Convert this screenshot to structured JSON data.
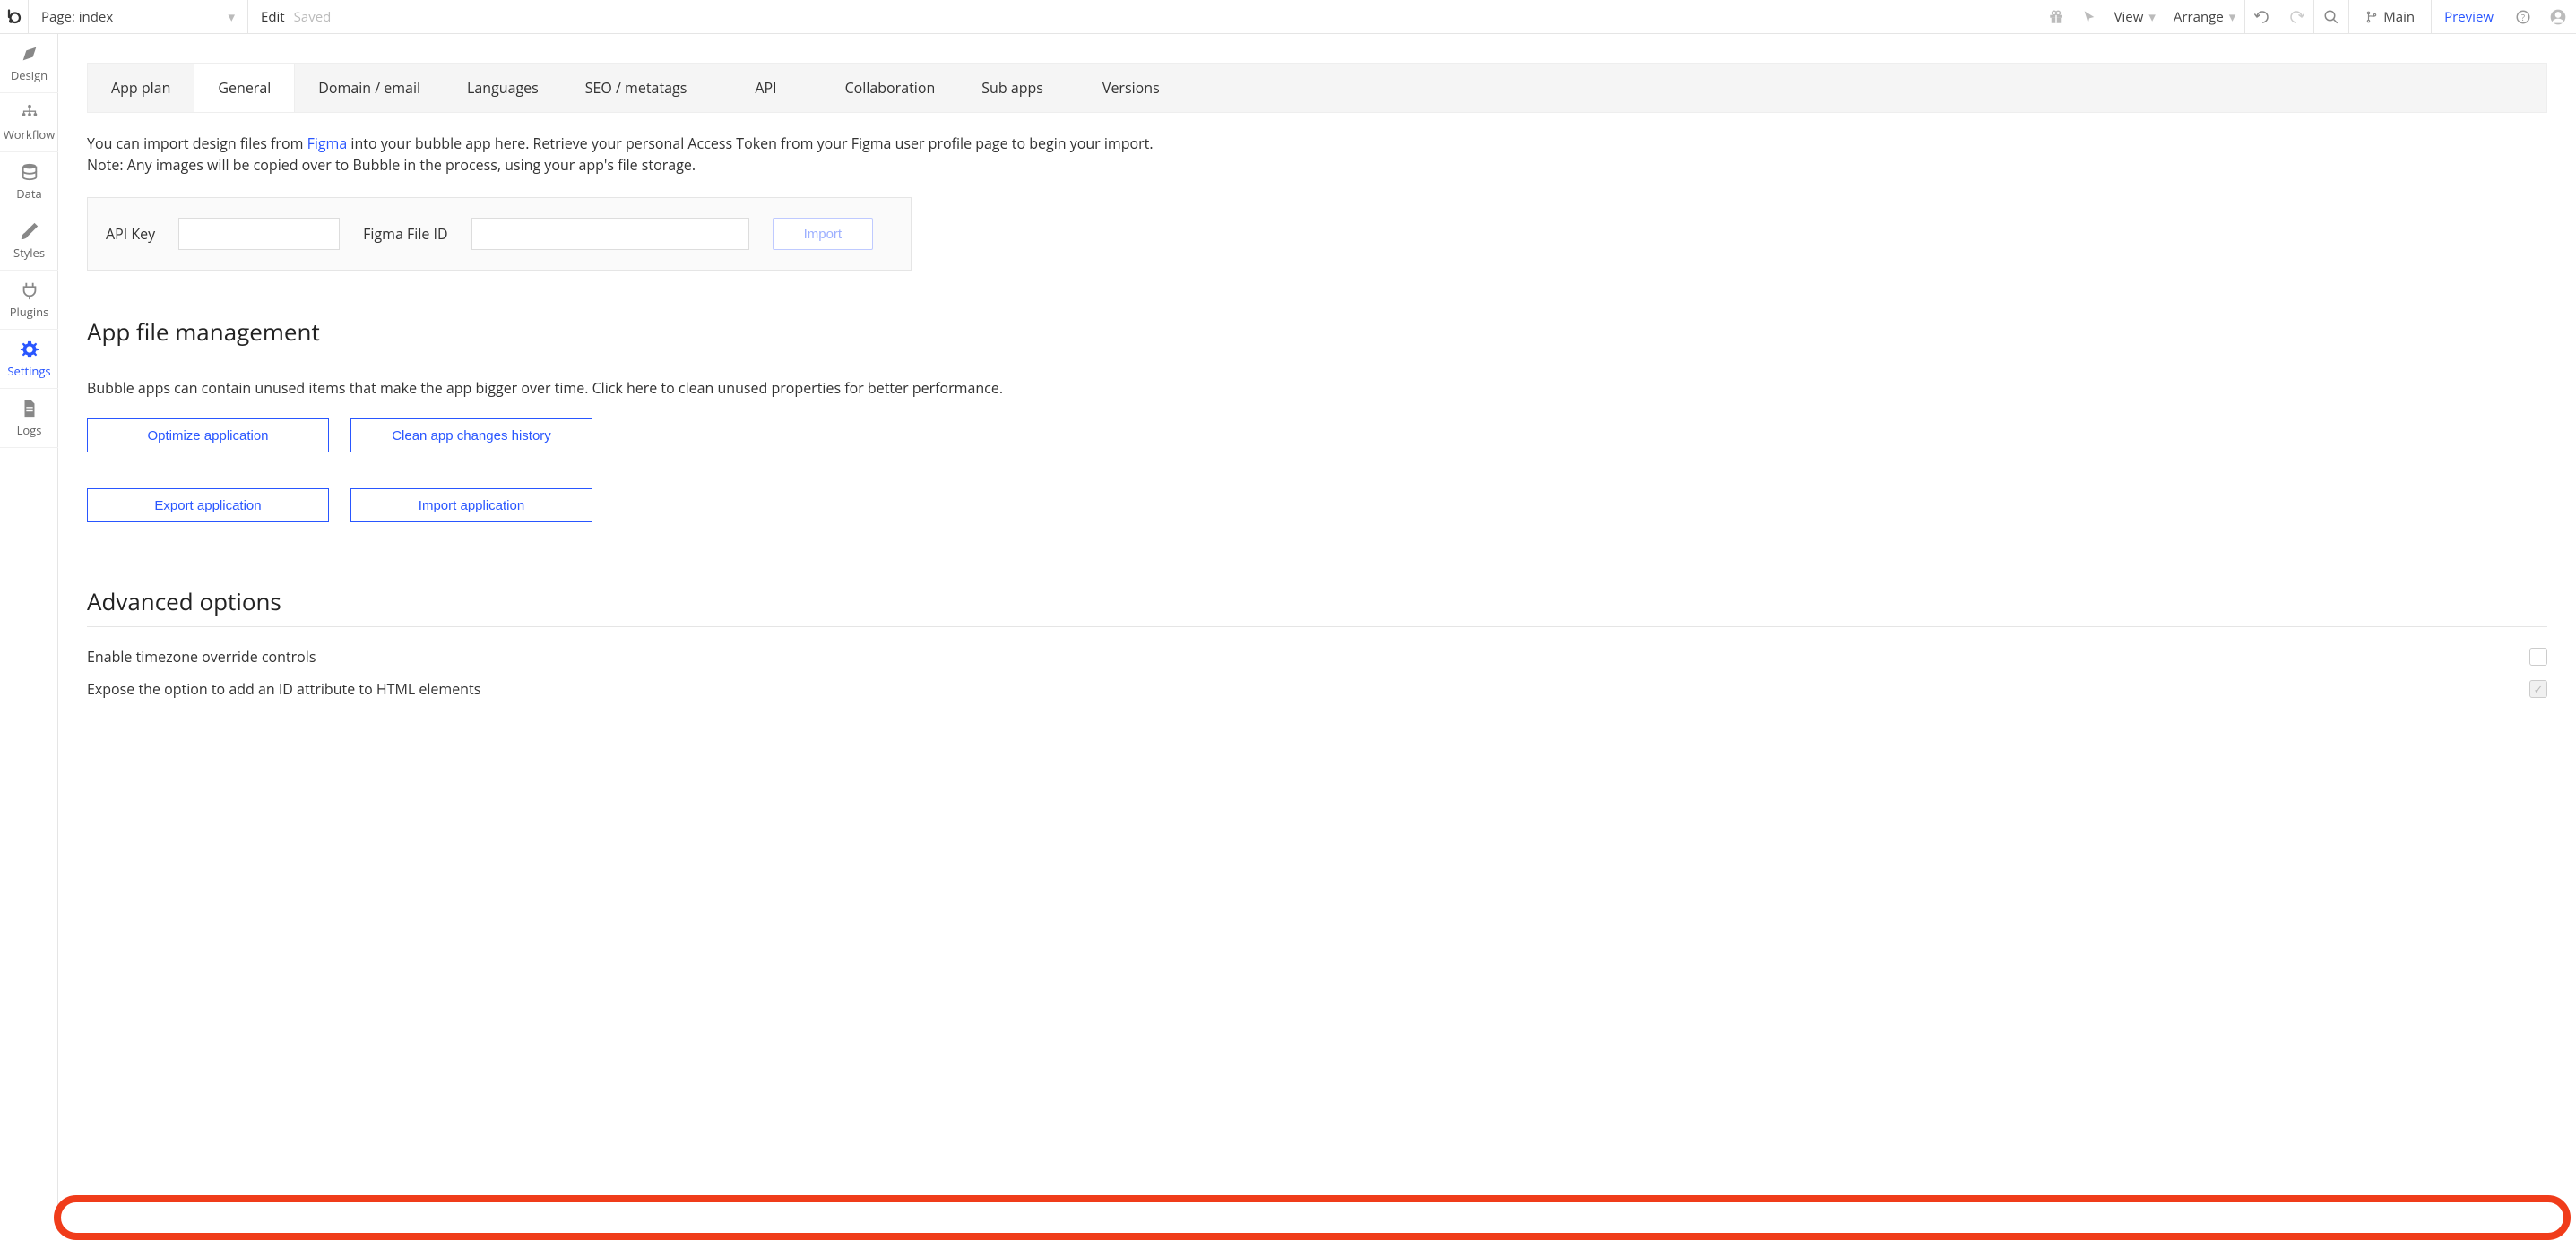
{
  "topbar": {
    "page_label": "Page: index",
    "edit_label": "Edit",
    "saved_label": "Saved",
    "view_label": "View",
    "arrange_label": "Arrange",
    "branch_label": "Main",
    "preview_label": "Preview"
  },
  "sidebar": {
    "items": [
      {
        "label": "Design"
      },
      {
        "label": "Workflow"
      },
      {
        "label": "Data"
      },
      {
        "label": "Styles"
      },
      {
        "label": "Plugins"
      },
      {
        "label": "Settings"
      },
      {
        "label": "Logs"
      }
    ]
  },
  "tabs": [
    "App plan",
    "General",
    "Domain / email",
    "Languages",
    "SEO / metatags",
    "API",
    "Collaboration",
    "Sub apps",
    "Versions"
  ],
  "figma": {
    "intro_prefix": "You can import design files from ",
    "figma_link": "Figma",
    "intro_suffix": " into your bubble app here. Retrieve your personal Access Token from your Figma user profile page to begin your import.",
    "note": "Note: Any images will be copied over to Bubble in the process, using your app's file storage.",
    "api_key_label": "API Key",
    "file_id_label": "Figma File ID",
    "import_button": "Import"
  },
  "file_mgmt": {
    "heading": "App file management",
    "desc": "Bubble apps can contain unused items that make the app bigger over time. Click here to clean unused properties for better performance.",
    "optimize_btn": "Optimize application",
    "clean_btn": "Clean app changes history",
    "export_btn": "Export application",
    "import_btn": "Import application"
  },
  "advanced": {
    "heading": "Advanced options",
    "option1": "Enable timezone override controls",
    "option2": "Expose the option to add an ID attribute to HTML elements"
  }
}
